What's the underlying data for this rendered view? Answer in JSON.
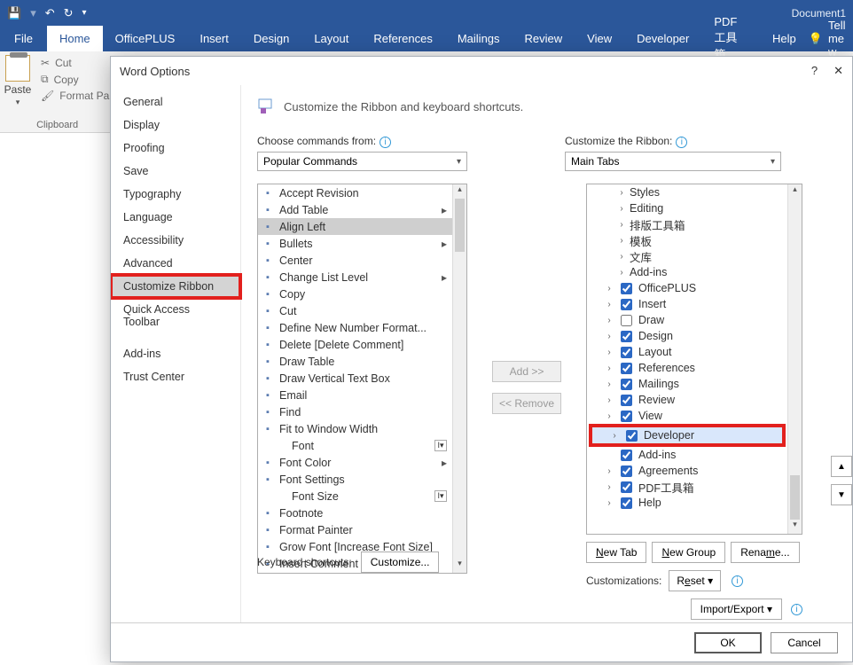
{
  "title_bar": {
    "doc_title": "Document1"
  },
  "ribbon": {
    "tabs": [
      "File",
      "Home",
      "OfficePLUS",
      "Insert",
      "Design",
      "Layout",
      "References",
      "Mailings",
      "Review",
      "View",
      "Developer",
      "PDF工具箱",
      "Help"
    ],
    "tellme": "Tell me w",
    "clipboard": {
      "paste": "Paste",
      "cut": "Cut",
      "copy": "Copy",
      "format_painter": "Format Pa",
      "group": "Clipboard"
    }
  },
  "dialog": {
    "title": "Word Options",
    "nav": [
      "General",
      "Display",
      "Proofing",
      "Save",
      "Typography",
      "Language",
      "Accessibility",
      "Advanced",
      "Customize Ribbon",
      "Quick Access Toolbar",
      "Add-ins",
      "Trust Center"
    ],
    "heading": "Customize the Ribbon and keyboard shortcuts.",
    "choose_label": "Choose commands from:",
    "choose_value": "Popular Commands",
    "customize_label": "Customize the Ribbon:",
    "customize_value": "Main Tabs",
    "commands": [
      {
        "t": "Accept Revision"
      },
      {
        "t": "Add Table",
        "more": true
      },
      {
        "t": "Align Left",
        "sel": true
      },
      {
        "t": "Bullets",
        "more": true
      },
      {
        "t": "Center"
      },
      {
        "t": "Change List Level",
        "more": true
      },
      {
        "t": "Copy"
      },
      {
        "t": "Cut"
      },
      {
        "t": "Define New Number Format..."
      },
      {
        "t": "Delete [Delete Comment]"
      },
      {
        "t": "Draw Table"
      },
      {
        "t": "Draw Vertical Text Box"
      },
      {
        "t": "Email"
      },
      {
        "t": "Find"
      },
      {
        "t": "Fit to Window Width"
      },
      {
        "t": "Font",
        "dd": true,
        "indent": true
      },
      {
        "t": "Font Color",
        "more": true
      },
      {
        "t": "Font Settings"
      },
      {
        "t": "Font Size",
        "dd": true,
        "indent": true
      },
      {
        "t": "Footnote"
      },
      {
        "t": "Format Painter"
      },
      {
        "t": "Grow Font [Increase Font Size]"
      },
      {
        "t": "Insert Comment"
      }
    ],
    "mid": {
      "add": "Add >>",
      "remove": "<< Remove"
    },
    "tree": [
      {
        "t": "Styles",
        "indent": 2,
        "exp": ">"
      },
      {
        "t": "Editing",
        "indent": 2,
        "exp": ">"
      },
      {
        "t": "排版工具箱",
        "indent": 2,
        "exp": ">"
      },
      {
        "t": "模板",
        "indent": 2,
        "exp": ">"
      },
      {
        "t": "文库",
        "indent": 2,
        "exp": ">"
      },
      {
        "t": "Add-ins",
        "indent": 2,
        "exp": ">"
      },
      {
        "t": "OfficePLUS",
        "indent": 1,
        "exp": ">",
        "cb": true
      },
      {
        "t": "Insert",
        "indent": 1,
        "exp": ">",
        "cb": true
      },
      {
        "t": "Draw",
        "indent": 1,
        "exp": ">",
        "cb": false
      },
      {
        "t": "Design",
        "indent": 1,
        "exp": ">",
        "cb": true
      },
      {
        "t": "Layout",
        "indent": 1,
        "exp": ">",
        "cb": true
      },
      {
        "t": "References",
        "indent": 1,
        "exp": ">",
        "cb": true
      },
      {
        "t": "Mailings",
        "indent": 1,
        "exp": ">",
        "cb": true
      },
      {
        "t": "Review",
        "indent": 1,
        "exp": ">",
        "cb": true
      },
      {
        "t": "View",
        "indent": 1,
        "exp": ">",
        "cb": true
      },
      {
        "t": "Developer",
        "indent": 1,
        "exp": ">",
        "cb": true,
        "hl": true
      },
      {
        "t": "Add-ins",
        "indent": 1,
        "exp": "",
        "cb": true,
        "noexp": true
      },
      {
        "t": "Agreements",
        "indent": 1,
        "exp": ">",
        "cb": true
      },
      {
        "t": "PDF工具箱",
        "indent": 1,
        "exp": ">",
        "cb": true
      },
      {
        "t": "Help",
        "indent": 1,
        "exp": ">",
        "cb": true
      }
    ],
    "btns": {
      "new_tab": "New Tab",
      "new_group": "New Group",
      "rename": "Rename...",
      "cust": "Customizations:",
      "reset": "Reset",
      "import": "Import/Export"
    },
    "kbd": {
      "label": "Keyboard shortcuts:",
      "btn": "Customize..."
    },
    "footer": {
      "ok": "OK",
      "cancel": "Cancel"
    }
  }
}
